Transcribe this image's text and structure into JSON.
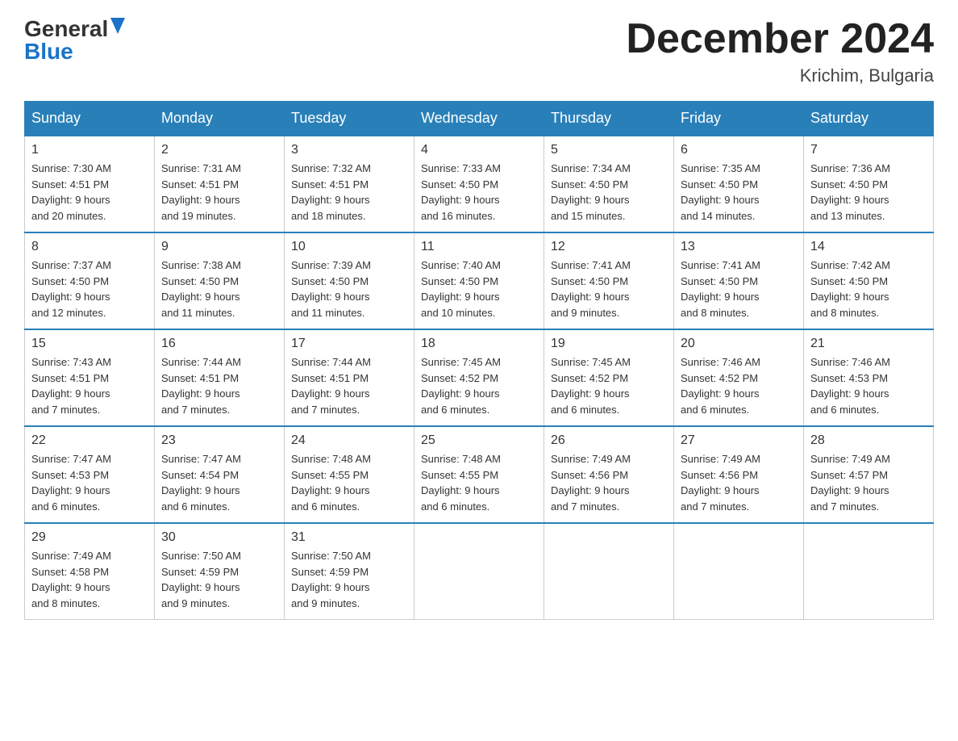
{
  "header": {
    "logo_general": "General",
    "logo_blue": "Blue",
    "month_title": "December 2024",
    "location": "Krichim, Bulgaria"
  },
  "days_of_week": [
    "Sunday",
    "Monday",
    "Tuesday",
    "Wednesday",
    "Thursday",
    "Friday",
    "Saturday"
  ],
  "weeks": [
    [
      {
        "day": "1",
        "sunrise": "7:30 AM",
        "sunset": "4:51 PM",
        "daylight": "9 hours and 20 minutes."
      },
      {
        "day": "2",
        "sunrise": "7:31 AM",
        "sunset": "4:51 PM",
        "daylight": "9 hours and 19 minutes."
      },
      {
        "day": "3",
        "sunrise": "7:32 AM",
        "sunset": "4:51 PM",
        "daylight": "9 hours and 18 minutes."
      },
      {
        "day": "4",
        "sunrise": "7:33 AM",
        "sunset": "4:50 PM",
        "daylight": "9 hours and 16 minutes."
      },
      {
        "day": "5",
        "sunrise": "7:34 AM",
        "sunset": "4:50 PM",
        "daylight": "9 hours and 15 minutes."
      },
      {
        "day": "6",
        "sunrise": "7:35 AM",
        "sunset": "4:50 PM",
        "daylight": "9 hours and 14 minutes."
      },
      {
        "day": "7",
        "sunrise": "7:36 AM",
        "sunset": "4:50 PM",
        "daylight": "9 hours and 13 minutes."
      }
    ],
    [
      {
        "day": "8",
        "sunrise": "7:37 AM",
        "sunset": "4:50 PM",
        "daylight": "9 hours and 12 minutes."
      },
      {
        "day": "9",
        "sunrise": "7:38 AM",
        "sunset": "4:50 PM",
        "daylight": "9 hours and 11 minutes."
      },
      {
        "day": "10",
        "sunrise": "7:39 AM",
        "sunset": "4:50 PM",
        "daylight": "9 hours and 11 minutes."
      },
      {
        "day": "11",
        "sunrise": "7:40 AM",
        "sunset": "4:50 PM",
        "daylight": "9 hours and 10 minutes."
      },
      {
        "day": "12",
        "sunrise": "7:41 AM",
        "sunset": "4:50 PM",
        "daylight": "9 hours and 9 minutes."
      },
      {
        "day": "13",
        "sunrise": "7:41 AM",
        "sunset": "4:50 PM",
        "daylight": "9 hours and 8 minutes."
      },
      {
        "day": "14",
        "sunrise": "7:42 AM",
        "sunset": "4:50 PM",
        "daylight": "9 hours and 8 minutes."
      }
    ],
    [
      {
        "day": "15",
        "sunrise": "7:43 AM",
        "sunset": "4:51 PM",
        "daylight": "9 hours and 7 minutes."
      },
      {
        "day": "16",
        "sunrise": "7:44 AM",
        "sunset": "4:51 PM",
        "daylight": "9 hours and 7 minutes."
      },
      {
        "day": "17",
        "sunrise": "7:44 AM",
        "sunset": "4:51 PM",
        "daylight": "9 hours and 7 minutes."
      },
      {
        "day": "18",
        "sunrise": "7:45 AM",
        "sunset": "4:52 PM",
        "daylight": "9 hours and 6 minutes."
      },
      {
        "day": "19",
        "sunrise": "7:45 AM",
        "sunset": "4:52 PM",
        "daylight": "9 hours and 6 minutes."
      },
      {
        "day": "20",
        "sunrise": "7:46 AM",
        "sunset": "4:52 PM",
        "daylight": "9 hours and 6 minutes."
      },
      {
        "day": "21",
        "sunrise": "7:46 AM",
        "sunset": "4:53 PM",
        "daylight": "9 hours and 6 minutes."
      }
    ],
    [
      {
        "day": "22",
        "sunrise": "7:47 AM",
        "sunset": "4:53 PM",
        "daylight": "9 hours and 6 minutes."
      },
      {
        "day": "23",
        "sunrise": "7:47 AM",
        "sunset": "4:54 PM",
        "daylight": "9 hours and 6 minutes."
      },
      {
        "day": "24",
        "sunrise": "7:48 AM",
        "sunset": "4:55 PM",
        "daylight": "9 hours and 6 minutes."
      },
      {
        "day": "25",
        "sunrise": "7:48 AM",
        "sunset": "4:55 PM",
        "daylight": "9 hours and 6 minutes."
      },
      {
        "day": "26",
        "sunrise": "7:49 AM",
        "sunset": "4:56 PM",
        "daylight": "9 hours and 7 minutes."
      },
      {
        "day": "27",
        "sunrise": "7:49 AM",
        "sunset": "4:56 PM",
        "daylight": "9 hours and 7 minutes."
      },
      {
        "day": "28",
        "sunrise": "7:49 AM",
        "sunset": "4:57 PM",
        "daylight": "9 hours and 7 minutes."
      }
    ],
    [
      {
        "day": "29",
        "sunrise": "7:49 AM",
        "sunset": "4:58 PM",
        "daylight": "9 hours and 8 minutes."
      },
      {
        "day": "30",
        "sunrise": "7:50 AM",
        "sunset": "4:59 PM",
        "daylight": "9 hours and 9 minutes."
      },
      {
        "day": "31",
        "sunrise": "7:50 AM",
        "sunset": "4:59 PM",
        "daylight": "9 hours and 9 minutes."
      },
      null,
      null,
      null,
      null
    ]
  ],
  "labels": {
    "sunrise_prefix": "Sunrise: ",
    "sunset_prefix": "Sunset: ",
    "daylight_prefix": "Daylight: "
  }
}
